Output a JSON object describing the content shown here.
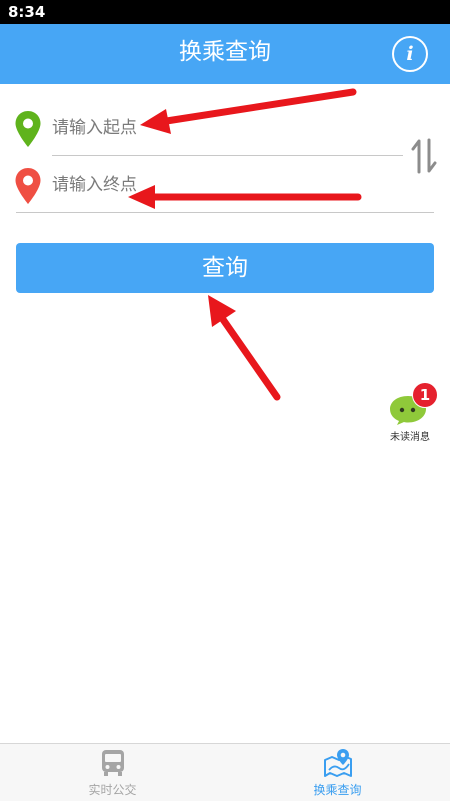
{
  "status_bar": {
    "time": "8:34"
  },
  "app_bar": {
    "title": "换乘查询",
    "info_icon": "info-icon"
  },
  "form": {
    "start_placeholder": "请输入起点",
    "end_placeholder": "请输入终点",
    "start_pin_color": "#5fb31c",
    "end_pin_color": "#ef4f43",
    "swap_icon": "swap-vertical-icon"
  },
  "query_button": {
    "label": "查询"
  },
  "unread": {
    "count": "1",
    "label": "未读消息"
  },
  "bottom_nav": {
    "items": [
      {
        "label": "实时公交",
        "icon": "bus-icon",
        "active": false
      },
      {
        "label": "换乘查询",
        "icon": "map-route-icon",
        "active": true
      }
    ]
  },
  "colors": {
    "primary": "#47a6f5",
    "annotation_arrow": "#e8171c",
    "nav_inactive": "#a5a5a5",
    "nav_active": "#3a9ef0"
  }
}
